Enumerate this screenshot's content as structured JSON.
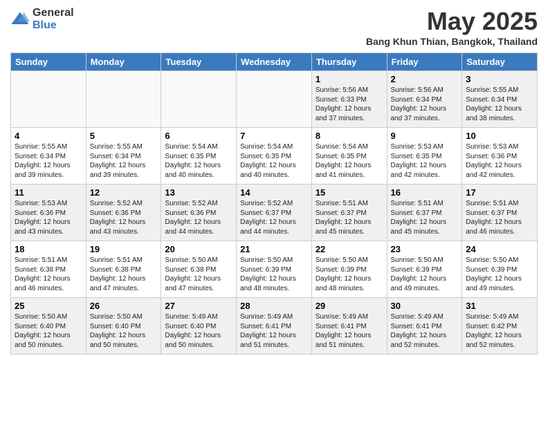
{
  "header": {
    "logo_general": "General",
    "logo_blue": "Blue",
    "month_title": "May 2025",
    "location": "Bang Khun Thian, Bangkok, Thailand"
  },
  "days_of_week": [
    "Sunday",
    "Monday",
    "Tuesday",
    "Wednesday",
    "Thursday",
    "Friday",
    "Saturday"
  ],
  "weeks": [
    [
      {
        "day": "",
        "info": "",
        "empty": true
      },
      {
        "day": "",
        "info": "",
        "empty": true
      },
      {
        "day": "",
        "info": "",
        "empty": true
      },
      {
        "day": "",
        "info": "",
        "empty": true
      },
      {
        "day": "1",
        "info": "Sunrise: 5:56 AM\nSunset: 6:33 PM\nDaylight: 12 hours\nand 37 minutes.",
        "empty": false
      },
      {
        "day": "2",
        "info": "Sunrise: 5:56 AM\nSunset: 6:34 PM\nDaylight: 12 hours\nand 37 minutes.",
        "empty": false
      },
      {
        "day": "3",
        "info": "Sunrise: 5:55 AM\nSunset: 6:34 PM\nDaylight: 12 hours\nand 38 minutes.",
        "empty": false
      }
    ],
    [
      {
        "day": "4",
        "info": "Sunrise: 5:55 AM\nSunset: 6:34 PM\nDaylight: 12 hours\nand 39 minutes.",
        "empty": false
      },
      {
        "day": "5",
        "info": "Sunrise: 5:55 AM\nSunset: 6:34 PM\nDaylight: 12 hours\nand 39 minutes.",
        "empty": false
      },
      {
        "day": "6",
        "info": "Sunrise: 5:54 AM\nSunset: 6:35 PM\nDaylight: 12 hours\nand 40 minutes.",
        "empty": false
      },
      {
        "day": "7",
        "info": "Sunrise: 5:54 AM\nSunset: 6:35 PM\nDaylight: 12 hours\nand 40 minutes.",
        "empty": false
      },
      {
        "day": "8",
        "info": "Sunrise: 5:54 AM\nSunset: 6:35 PM\nDaylight: 12 hours\nand 41 minutes.",
        "empty": false
      },
      {
        "day": "9",
        "info": "Sunrise: 5:53 AM\nSunset: 6:35 PM\nDaylight: 12 hours\nand 42 minutes.",
        "empty": false
      },
      {
        "day": "10",
        "info": "Sunrise: 5:53 AM\nSunset: 6:36 PM\nDaylight: 12 hours\nand 42 minutes.",
        "empty": false
      }
    ],
    [
      {
        "day": "11",
        "info": "Sunrise: 5:53 AM\nSunset: 6:36 PM\nDaylight: 12 hours\nand 43 minutes.",
        "empty": false
      },
      {
        "day": "12",
        "info": "Sunrise: 5:52 AM\nSunset: 6:36 PM\nDaylight: 12 hours\nand 43 minutes.",
        "empty": false
      },
      {
        "day": "13",
        "info": "Sunrise: 5:52 AM\nSunset: 6:36 PM\nDaylight: 12 hours\nand 44 minutes.",
        "empty": false
      },
      {
        "day": "14",
        "info": "Sunrise: 5:52 AM\nSunset: 6:37 PM\nDaylight: 12 hours\nand 44 minutes.",
        "empty": false
      },
      {
        "day": "15",
        "info": "Sunrise: 5:51 AM\nSunset: 6:37 PM\nDaylight: 12 hours\nand 45 minutes.",
        "empty": false
      },
      {
        "day": "16",
        "info": "Sunrise: 5:51 AM\nSunset: 6:37 PM\nDaylight: 12 hours\nand 45 minutes.",
        "empty": false
      },
      {
        "day": "17",
        "info": "Sunrise: 5:51 AM\nSunset: 6:37 PM\nDaylight: 12 hours\nand 46 minutes.",
        "empty": false
      }
    ],
    [
      {
        "day": "18",
        "info": "Sunrise: 5:51 AM\nSunset: 6:38 PM\nDaylight: 12 hours\nand 46 minutes.",
        "empty": false
      },
      {
        "day": "19",
        "info": "Sunrise: 5:51 AM\nSunset: 6:38 PM\nDaylight: 12 hours\nand 47 minutes.",
        "empty": false
      },
      {
        "day": "20",
        "info": "Sunrise: 5:50 AM\nSunset: 6:38 PM\nDaylight: 12 hours\nand 47 minutes.",
        "empty": false
      },
      {
        "day": "21",
        "info": "Sunrise: 5:50 AM\nSunset: 6:39 PM\nDaylight: 12 hours\nand 48 minutes.",
        "empty": false
      },
      {
        "day": "22",
        "info": "Sunrise: 5:50 AM\nSunset: 6:39 PM\nDaylight: 12 hours\nand 48 minutes.",
        "empty": false
      },
      {
        "day": "23",
        "info": "Sunrise: 5:50 AM\nSunset: 6:39 PM\nDaylight: 12 hours\nand 49 minutes.",
        "empty": false
      },
      {
        "day": "24",
        "info": "Sunrise: 5:50 AM\nSunset: 6:39 PM\nDaylight: 12 hours\nand 49 minutes.",
        "empty": false
      }
    ],
    [
      {
        "day": "25",
        "info": "Sunrise: 5:50 AM\nSunset: 6:40 PM\nDaylight: 12 hours\nand 50 minutes.",
        "empty": false
      },
      {
        "day": "26",
        "info": "Sunrise: 5:50 AM\nSunset: 6:40 PM\nDaylight: 12 hours\nand 50 minutes.",
        "empty": false
      },
      {
        "day": "27",
        "info": "Sunrise: 5:49 AM\nSunset: 6:40 PM\nDaylight: 12 hours\nand 50 minutes.",
        "empty": false
      },
      {
        "day": "28",
        "info": "Sunrise: 5:49 AM\nSunset: 6:41 PM\nDaylight: 12 hours\nand 51 minutes.",
        "empty": false
      },
      {
        "day": "29",
        "info": "Sunrise: 5:49 AM\nSunset: 6:41 PM\nDaylight: 12 hours\nand 51 minutes.",
        "empty": false
      },
      {
        "day": "30",
        "info": "Sunrise: 5:49 AM\nSunset: 6:41 PM\nDaylight: 12 hours\nand 52 minutes.",
        "empty": false
      },
      {
        "day": "31",
        "info": "Sunrise: 5:49 AM\nSunset: 6:42 PM\nDaylight: 12 hours\nand 52 minutes.",
        "empty": false
      }
    ]
  ]
}
